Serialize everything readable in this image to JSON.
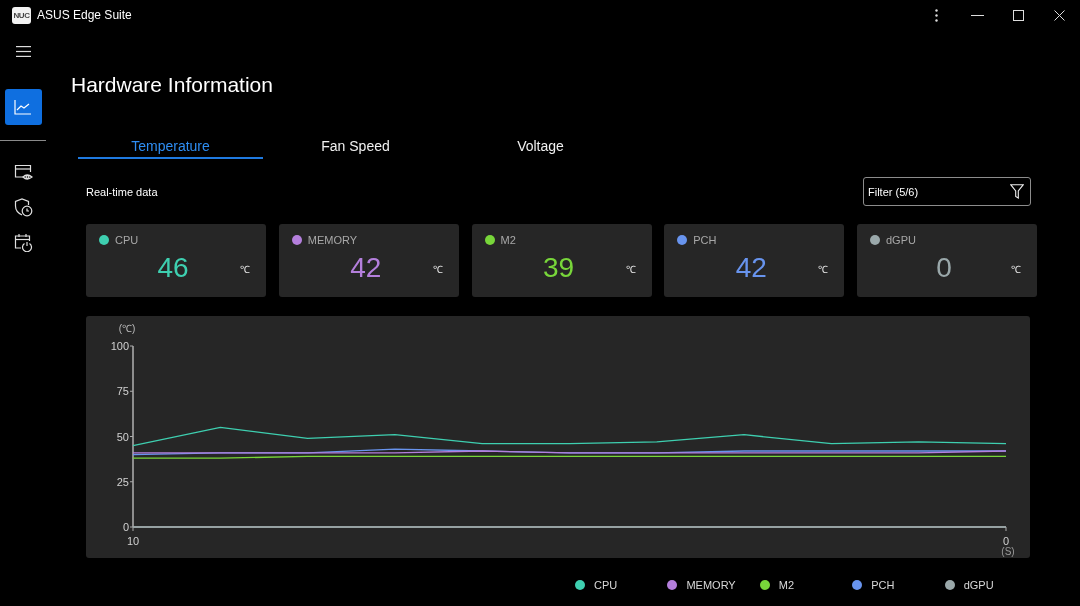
{
  "window": {
    "logo": "NUC",
    "title": "ASUS Edge Suite"
  },
  "sidebar": {
    "items": [
      {
        "kind": "chart",
        "selected": true
      },
      {
        "kind": "monitor",
        "selected": false
      },
      {
        "kind": "shield",
        "selected": false
      },
      {
        "kind": "calendar",
        "selected": false
      }
    ]
  },
  "page": {
    "title": "Hardware Information"
  },
  "tabs": [
    {
      "label": "Temperature",
      "selected": true
    },
    {
      "label": "Fan Speed",
      "selected": false
    },
    {
      "label": "Voltage",
      "selected": false
    }
  ],
  "section_label": "Real-time data",
  "filter": {
    "label": "Filter (5/6)"
  },
  "sensors": [
    {
      "name": "CPU",
      "color": "#3ecfb0",
      "value": "46",
      "unit": "℃"
    },
    {
      "name": "MEMORY",
      "color": "#b47fdc",
      "value": "42",
      "unit": "℃"
    },
    {
      "name": "M2",
      "color": "#78d63a",
      "value": "39",
      "unit": "℃"
    },
    {
      "name": "PCH",
      "color": "#6894ee",
      "value": "42",
      "unit": "℃"
    },
    {
      "name": "dGPU",
      "color": "#9aa8aa",
      "value": "0",
      "unit": "℃"
    }
  ],
  "chart": {
    "chart_data": {
      "type": "line",
      "ylabel": "(℃)",
      "xlabel": "(S)",
      "x": [
        10,
        9,
        8,
        7,
        6,
        5,
        4,
        3,
        2,
        1,
        0
      ],
      "xlim": [
        10,
        0
      ],
      "ylim": [
        0,
        100
      ],
      "xticks": [
        10,
        0
      ],
      "yticks": [
        0,
        25,
        50,
        75,
        100
      ],
      "series": [
        {
          "name": "CPU",
          "color": "#3ecfb0",
          "values": [
            45,
            55,
            49,
            51,
            46,
            46,
            47,
            51,
            46,
            47,
            46
          ]
        },
        {
          "name": "MEMORY",
          "color": "#b47fdc",
          "values": [
            41,
            41,
            41,
            41,
            42,
            41,
            41,
            41,
            41,
            41,
            42
          ]
        },
        {
          "name": "M2",
          "color": "#78d63a",
          "values": [
            38,
            38,
            39,
            39,
            39,
            39,
            39,
            39,
            39,
            39,
            39
          ]
        },
        {
          "name": "PCH",
          "color": "#6894ee",
          "values": [
            40,
            41,
            41,
            43,
            42,
            41,
            41,
            42,
            42,
            42,
            42
          ]
        },
        {
          "name": "dGPU",
          "color": "#9aa8aa",
          "values": [
            0,
            0,
            0,
            0,
            0,
            0,
            0,
            0,
            0,
            0,
            0
          ]
        }
      ]
    }
  }
}
